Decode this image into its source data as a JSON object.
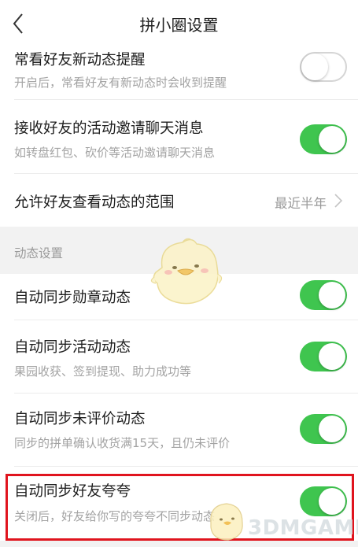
{
  "header": {
    "title": "拼小圈设置"
  },
  "settings_top": [
    {
      "title": "常看好友新动态提醒",
      "subtitle": "开启后，常看好友有新动态时会收到提醒",
      "toggle": "off"
    },
    {
      "title": "接收好友的活动邀请聊天消息",
      "subtitle": "如转盘红包、砍价等活动邀请聊天消息",
      "toggle": "on"
    },
    {
      "title": "允许好友查看动态的范围",
      "value": "最近半年"
    }
  ],
  "section": {
    "label": "动态设置"
  },
  "settings_dynamic": [
    {
      "title": "自动同步勋章动态",
      "toggle": "on"
    },
    {
      "title": "自动同步活动动态",
      "subtitle": "果园收获、签到提现、助力成功等",
      "toggle": "on"
    },
    {
      "title": "自动同步未评价动态",
      "subtitle": "同步的拼单确认收货满15天，且仍未评价",
      "toggle": "on"
    },
    {
      "title": "自动同步好友夸夸",
      "subtitle": "关闭后，好友给你写的夸夸不同步动态",
      "toggle": "on"
    }
  ],
  "watermark": {
    "text": "3DMGAME"
  },
  "colors": {
    "toggle_on": "#3fc54f",
    "highlight": "#e0141e",
    "section_bg": "#f2f2f2"
  }
}
